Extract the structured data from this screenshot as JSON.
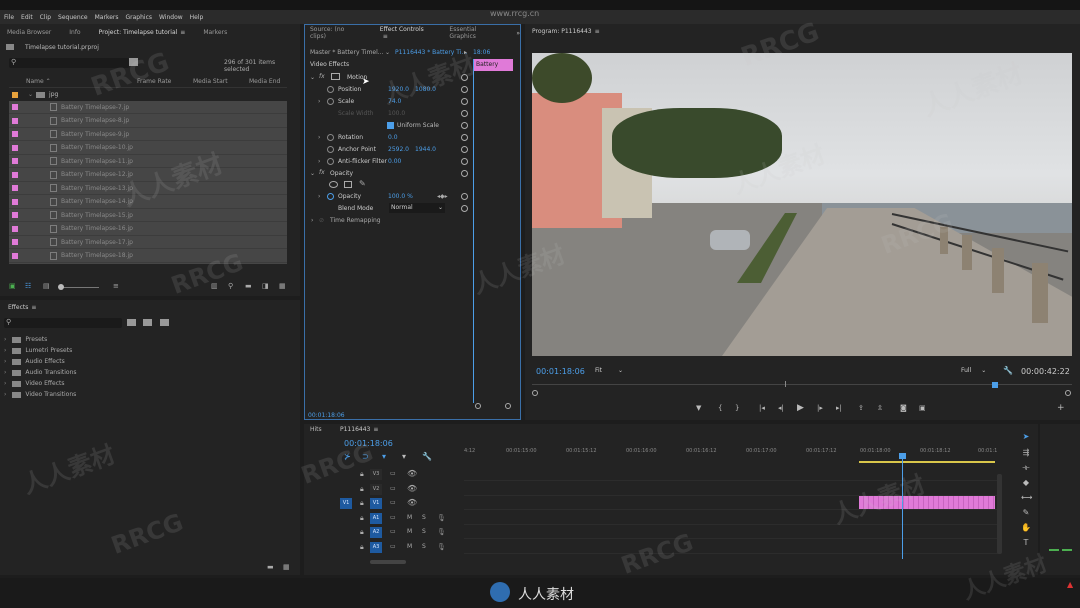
{
  "watermark": {
    "site": "www.rrcg.cn",
    "brand": "人人素材",
    "tag": "RRCG"
  },
  "menu": [
    "File",
    "Edit",
    "Clip",
    "Sequence",
    "Markers",
    "Graphics",
    "Window",
    "Help"
  ],
  "project_panel": {
    "tabs": [
      "Media Browser",
      "Info",
      "Project: Timelapse tutorial",
      "Markers"
    ],
    "project_file": "Timelapse tutorial.prproj",
    "items_selected": "296 of 301 items selected",
    "columns": [
      "Name",
      "Frame Rate",
      "Media Start",
      "Media End"
    ],
    "folder": "jpg",
    "files": [
      "Battery Timelapse-7.jp",
      "Battery Timelapse-8.jp",
      "Battery Timelapse-9.jp",
      "Battery Timelapse-10.jp",
      "Battery Timelapse-11.jp",
      "Battery Timelapse-12.jp",
      "Battery Timelapse-13.jp",
      "Battery Timelapse-14.jp",
      "Battery Timelapse-15.jp",
      "Battery Timelapse-16.jp",
      "Battery Timelapse-17.jp",
      "Battery Timelapse-18.jp"
    ],
    "accent_color": "#e07ad8"
  },
  "effects_panel": {
    "title": "Effects",
    "folders": [
      "Presets",
      "Lumetri Presets",
      "Audio Effects",
      "Audio Transitions",
      "Video Effects",
      "Video Transitions"
    ]
  },
  "effect_controls": {
    "tabs": [
      "Source: (no clips)",
      "Effect Controls",
      "Essential Graphics"
    ],
    "master": "Master * Battery Timel...",
    "sequence": "P1116443 * Battery Ti...",
    "clip_label": "Battery Time",
    "timecode_top": "18:06",
    "section": "Video Effects",
    "motion": "Motion",
    "position_label": "Position",
    "position_x": "1920.0",
    "position_y": "1080.0",
    "scale_label": "Scale",
    "scale_value": "74.0",
    "scale_width_label": "Scale Width",
    "scale_width_value": "100.0",
    "uniform_scale": "Uniform Scale",
    "rotation_label": "Rotation",
    "rotation_value": "0.0",
    "anchor_label": "Anchor Point",
    "anchor_x": "2592.0",
    "anchor_y": "1944.0",
    "antiflicker_label": "Anti-flicker Filter",
    "antiflicker_value": "0.00",
    "opacity_section": "Opacity",
    "opacity_label": "Opacity",
    "opacity_value": "100.0 %",
    "blend_label": "Blend Mode",
    "blend_value": "Normal",
    "time_remap": "Time Remapping",
    "timecode_bottom": "00:01:18:06"
  },
  "program_monitor": {
    "title": "Program: P1116443",
    "timecode": "00:01:18:06",
    "fit": "Fit",
    "quality": "Full",
    "duration": "00:00:42:22"
  },
  "timeline": {
    "tabs": [
      "Hits",
      "P1116443"
    ],
    "timecode": "00:01:18:06",
    "ruler": [
      "4:12",
      "00:01:15:00",
      "00:01:15:12",
      "00:01:16:00",
      "00:01:16:12",
      "00:01:17:00",
      "00:01:17:12",
      "00:01:18:00",
      "00:01:18:12",
      "00:01:1"
    ],
    "tracks": [
      "V3",
      "V2",
      "V1",
      "A1",
      "A2",
      "A3"
    ],
    "source_patch": "V1",
    "audio_flags": [
      "M",
      "S"
    ],
    "clip_color": "#e07ad8"
  }
}
